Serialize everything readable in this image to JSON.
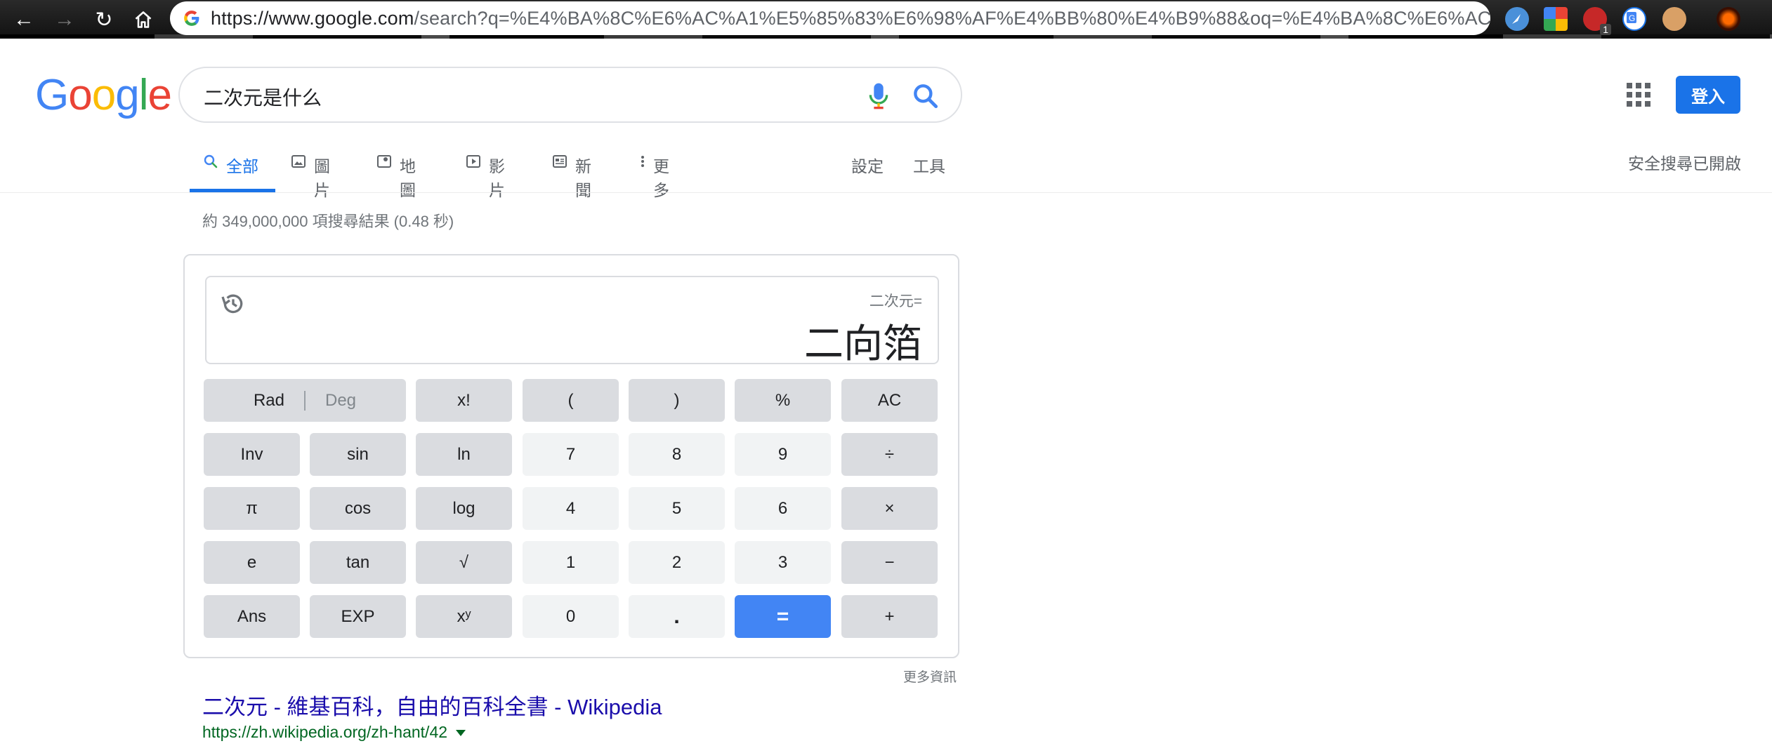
{
  "browser": {
    "url_host": "https://www.google.com",
    "url_rest": "/search?q=%E4%BA%8C%E6%AC%A1%E5%85%83%E6%98%AF%E4%BB%80%E4%B9%88&oq=%E4%BA%8C%E6%AC%A1%E...",
    "extension_badge": "1"
  },
  "header": {
    "logo": [
      "G",
      "o",
      "o",
      "g",
      "l",
      "e"
    ],
    "logo_colors": [
      "#4285f4",
      "#ea4335",
      "#fbbc05",
      "#4285f4",
      "#34a853",
      "#ea4335"
    ],
    "search_query": "二次元是什么",
    "signin_label": "登入"
  },
  "tabs": [
    {
      "label": "全部",
      "icon": "search-icon"
    },
    {
      "label": "圖片",
      "icon": "image-icon"
    },
    {
      "label": "地圖",
      "icon": "map-icon"
    },
    {
      "label": "影片",
      "icon": "video-icon"
    },
    {
      "label": "新聞",
      "icon": "news-icon"
    },
    {
      "label": "更多",
      "icon": "more-icon"
    }
  ],
  "tools": {
    "settings": "設定",
    "tools": "工具"
  },
  "safesearch": "安全搜尋已開啟",
  "result_stats": "約 349,000,000 項搜尋結果 (0.48 秒)",
  "calculator": {
    "expression": "二次元=",
    "result": "二向箔",
    "keys": {
      "rad": "Rad",
      "deg": "Deg",
      "fact": "x!",
      "lparen": "(",
      "rparen": ")",
      "percent": "%",
      "ac": "AC",
      "inv": "Inv",
      "sin": "sin",
      "ln": "ln",
      "k7": "7",
      "k8": "8",
      "k9": "9",
      "div": "÷",
      "pi": "π",
      "cos": "cos",
      "log": "log",
      "k4": "4",
      "k5": "5",
      "k6": "6",
      "mul": "×",
      "e": "e",
      "tan": "tan",
      "sqrt": "√",
      "k1": "1",
      "k2": "2",
      "k3": "3",
      "minus": "−",
      "ans": "Ans",
      "exp": "EXP",
      "pow": "xʸ",
      "k0": "0",
      "dot": ".",
      "eq": "=",
      "plus": "+"
    },
    "more_info": "更多資訊"
  },
  "first_result": {
    "title": "二次元 - 維基百科，自由的百科全書 - Wikipedia",
    "url": "https://zh.wikipedia.org/zh-hant/42"
  }
}
